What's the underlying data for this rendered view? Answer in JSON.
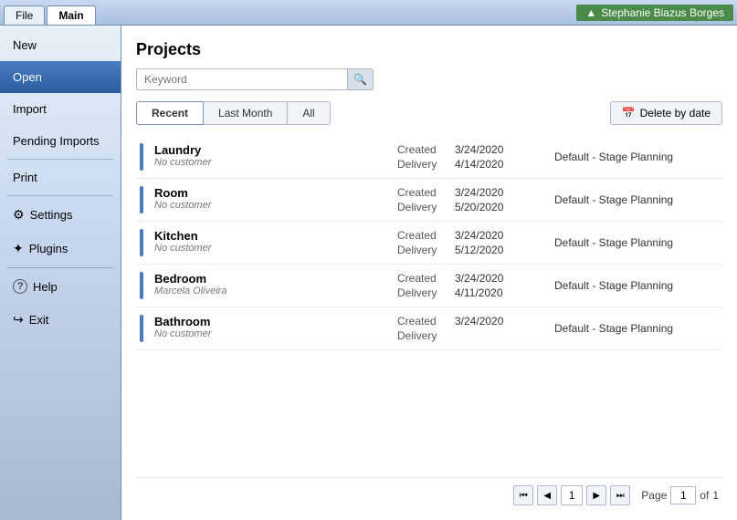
{
  "titleBar": {
    "tabs": [
      {
        "id": "file",
        "label": "File",
        "active": false
      },
      {
        "id": "main",
        "label": "Main",
        "active": true
      }
    ],
    "user": {
      "name": "Stephanie Biazus Borges",
      "icon": "▲"
    }
  },
  "sidebar": {
    "items": [
      {
        "id": "new",
        "label": "New",
        "active": false,
        "icon": ""
      },
      {
        "id": "open",
        "label": "Open",
        "active": true,
        "icon": ""
      },
      {
        "id": "import",
        "label": "Import",
        "active": false,
        "icon": ""
      },
      {
        "id": "pending",
        "label": "Pending Imports",
        "active": false,
        "icon": ""
      },
      {
        "id": "print",
        "label": "Print",
        "active": false,
        "icon": ""
      },
      {
        "id": "settings",
        "label": "Settings",
        "active": false,
        "icon": "⚙"
      },
      {
        "id": "plugins",
        "label": "Plugins",
        "active": false,
        "icon": "✦"
      },
      {
        "id": "help",
        "label": "Help",
        "active": false,
        "icon": "?"
      },
      {
        "id": "exit",
        "label": "Exit",
        "active": false,
        "icon": "↪"
      }
    ]
  },
  "content": {
    "title": "Projects",
    "search": {
      "placeholder": "Keyword",
      "value": ""
    },
    "tabs": [
      {
        "id": "recent",
        "label": "Recent",
        "active": true
      },
      {
        "id": "last-month",
        "label": "Last Month",
        "active": false
      },
      {
        "id": "all",
        "label": "All",
        "active": false
      }
    ],
    "deleteButton": "Delete by date",
    "projects": [
      {
        "name": "Laundry",
        "customer": "No customer",
        "createdDate": "3/24/2020",
        "deliveryDate": "4/14/2020",
        "stage": "Default - Stage Planning"
      },
      {
        "name": "Room",
        "customer": "No customer",
        "createdDate": "3/24/2020",
        "deliveryDate": "5/20/2020",
        "stage": "Default - Stage Planning"
      },
      {
        "name": "Kitchen",
        "customer": "No customer",
        "createdDate": "3/24/2020",
        "deliveryDate": "5/12/2020",
        "stage": "Default - Stage Planning"
      },
      {
        "name": "Bedroom",
        "customer": "Marcela Oliveira",
        "createdDate": "3/24/2020",
        "deliveryDate": "4/11/2020",
        "stage": "Default - Stage Planning"
      },
      {
        "name": "Bathroom",
        "customer": "No customer",
        "createdDate": "3/24/2020",
        "deliveryDate": "",
        "stage": "Default - Stage Planning"
      }
    ],
    "pagination": {
      "current": "1",
      "total": "1",
      "pageLabel": "Page",
      "ofLabel": "of"
    },
    "dateLabels": {
      "created": "Created",
      "delivery": "Delivery"
    }
  }
}
